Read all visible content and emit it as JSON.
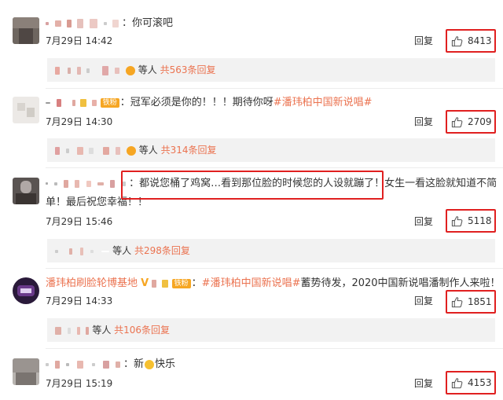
{
  "comments": [
    {
      "text": "：你可滚吧",
      "date": "7月29日 14:42",
      "reply_label": "回复",
      "likes": "8413",
      "sub": {
        "others": "等人",
        "count": "共563条回复"
      }
    },
    {
      "badge": "铁粉",
      "text": "：冠军必须是你的！！！期待你呀",
      "topic": "#潘玮柏中国新说唱#",
      "date": "7月29日 14:30",
      "reply_label": "回复",
      "likes": "2709",
      "sub": {
        "others": "等人",
        "count": "共314条回复"
      }
    },
    {
      "text": "：都说您桶了鸡窝…看到那位脸的时候您的人设就蹦了！女生一看这脸就知道不简",
      "text2": "单！最后祝您幸福！！",
      "date": "7月29日 15:46",
      "reply_label": "回复",
      "likes": "5118",
      "sub": {
        "others": "等人",
        "count": "共298条回复"
      }
    },
    {
      "name": "潘玮柏刷脸轮博基地",
      "badge": "铁粉",
      "text": "：",
      "topic": "#潘玮柏中国新说唱#",
      "text_after": "蓄势待发，2020中国新说唱潘制作人来啦！",
      "date": "7月29日 14:33",
      "reply_label": "回复",
      "likes": "1851",
      "sub": {
        "others": "等人",
        "count": "共106条回复"
      }
    },
    {
      "text": "：新",
      "text_after": "快乐",
      "date": "7月29日 15:19",
      "reply_label": "回复",
      "likes": "4153"
    }
  ],
  "colors": {
    "accent": "#eb7350",
    "highlight_border": "#e02020",
    "badge": "#f6a623"
  },
  "icons": {
    "like": "thumbs-up-icon",
    "verified": "verified-v-icon"
  }
}
